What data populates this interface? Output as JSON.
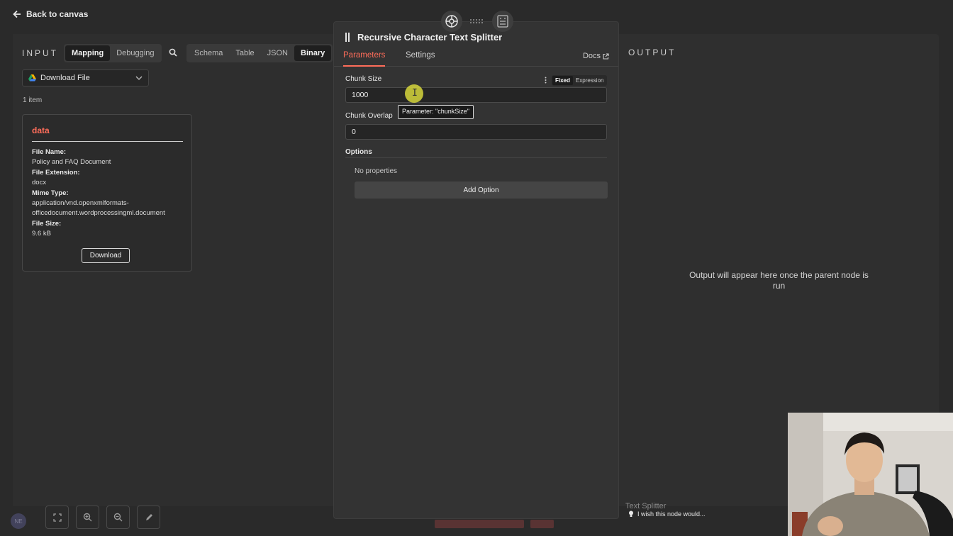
{
  "topbar": {
    "back_label": "Back to canvas"
  },
  "input": {
    "title": "INPUT",
    "mode_tabs": [
      "Mapping",
      "Debugging"
    ],
    "view_tabs": [
      "Schema",
      "Table",
      "JSON",
      "Binary"
    ],
    "active_view": "Binary",
    "node_select": "Download File",
    "item_count": "1 item",
    "binary": {
      "key": "data",
      "file_name_label": "File Name:",
      "file_name": "Policy and FAQ Document",
      "file_extension_label": "File Extension:",
      "file_extension": "docx",
      "mime_type_label": "Mime Type:",
      "mime_type_line1": "application/vnd.openxmlformats-",
      "mime_type_line2": "officedocument.wordprocessingml.document",
      "file_size_label": "File Size:",
      "file_size": "9.6 kB",
      "download_label": "Download"
    }
  },
  "node": {
    "title": "Recursive Character Text Splitter",
    "tabs": [
      "Parameters",
      "Settings"
    ],
    "docs_label": "Docs",
    "chunk_size_label": "Chunk Size",
    "chunk_size_value": "1000",
    "mode_toggle": [
      "Fixed",
      "Expression"
    ],
    "tooltip": "Parameter: \"chunkSize\"",
    "chunk_overlap_label": "Chunk Overlap",
    "chunk_overlap_value": "0",
    "options_label": "Options",
    "no_properties": "No properties",
    "add_option_label": "Add Option"
  },
  "output": {
    "title": "OUTPUT",
    "message": "Output will appear here once the parent node is run"
  },
  "canvas": {
    "ghost_node_label": "Text Splitter",
    "wish_label": "I wish this node would...",
    "avatar_initials": "NE"
  },
  "colors": {
    "accent": "#ff6d5a",
    "panel": "#333333",
    "background": "#2b2b2b"
  }
}
